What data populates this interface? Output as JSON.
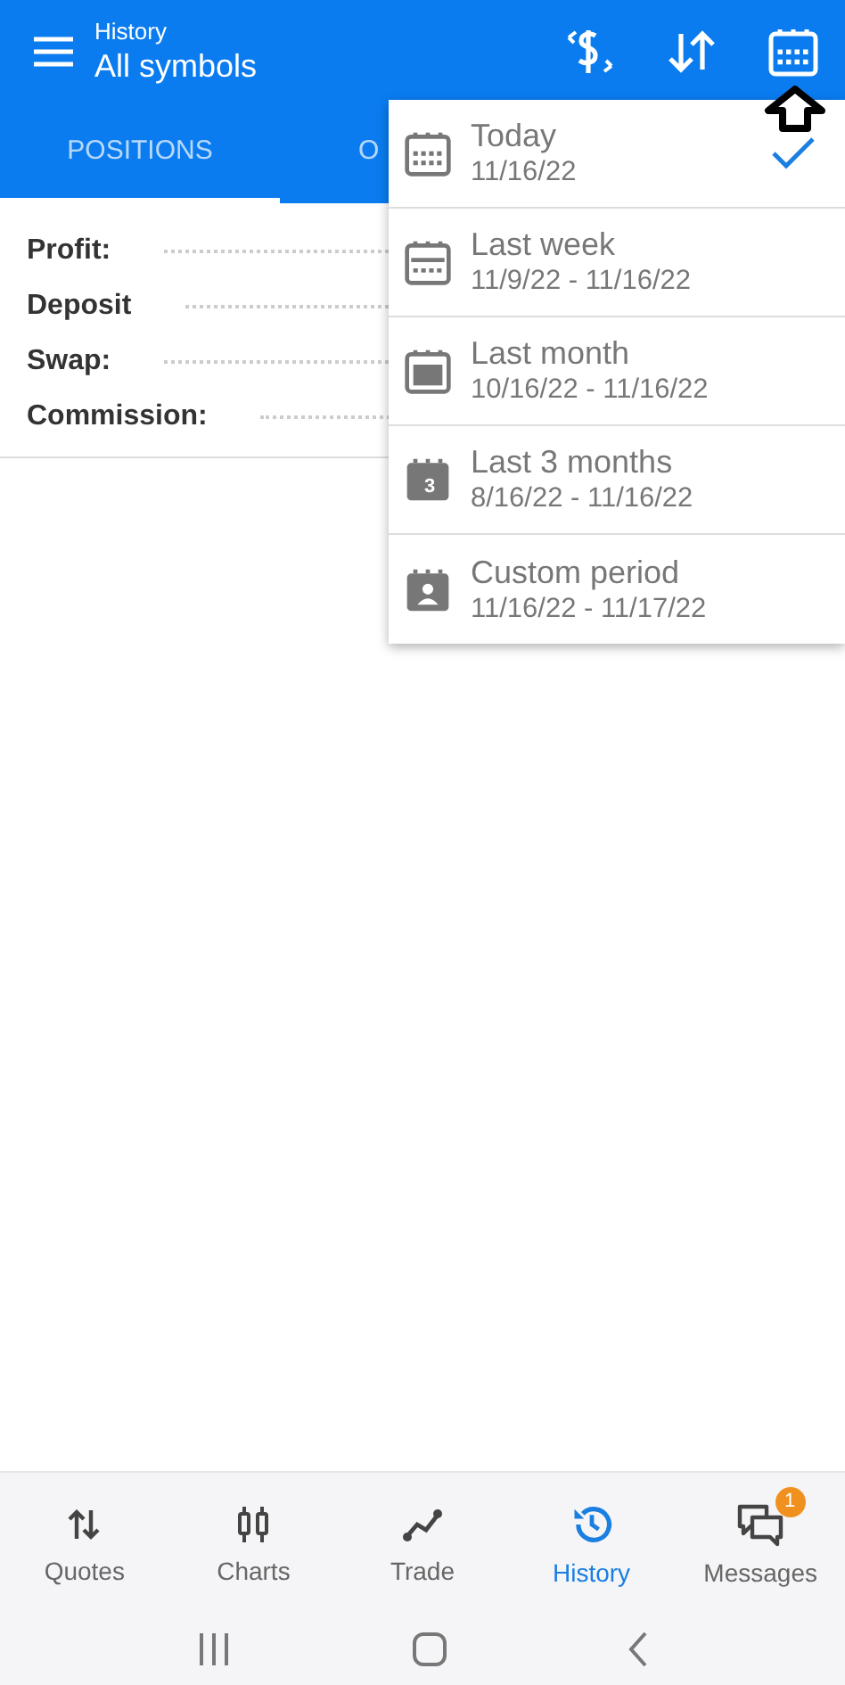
{
  "header": {
    "subtitle": "History",
    "title": "All symbols"
  },
  "tabs": [
    {
      "label": "POSITIONS",
      "selected": true
    },
    {
      "label": "O",
      "selected": false
    }
  ],
  "summary": [
    {
      "label": "Profit:"
    },
    {
      "label": "Deposit"
    },
    {
      "label": "Swap:"
    },
    {
      "label": "Commission:"
    }
  ],
  "period_menu": [
    {
      "kind": "today",
      "label": "Today",
      "range": "11/16/22",
      "selected": true
    },
    {
      "kind": "week",
      "label": "Last week",
      "range": "11/9/22 - 11/16/22",
      "selected": false
    },
    {
      "kind": "month",
      "label": "Last month",
      "range": "10/16/22 - 11/16/22",
      "selected": false
    },
    {
      "kind": "quarter",
      "label": "Last 3 months",
      "range": "8/16/22 - 11/16/22",
      "icon_text": "3",
      "selected": false
    },
    {
      "kind": "custom",
      "label": "Custom period",
      "range": "11/16/22 - 11/17/22",
      "selected": false
    }
  ],
  "bottom_nav": [
    {
      "kind": "quotes",
      "label": "Quotes",
      "selected": false
    },
    {
      "kind": "charts",
      "label": "Charts",
      "selected": false
    },
    {
      "kind": "trade",
      "label": "Trade",
      "selected": false
    },
    {
      "kind": "history",
      "label": "History",
      "selected": true
    },
    {
      "kind": "messages",
      "label": "Messages",
      "badge": "1",
      "selected": false
    }
  ]
}
